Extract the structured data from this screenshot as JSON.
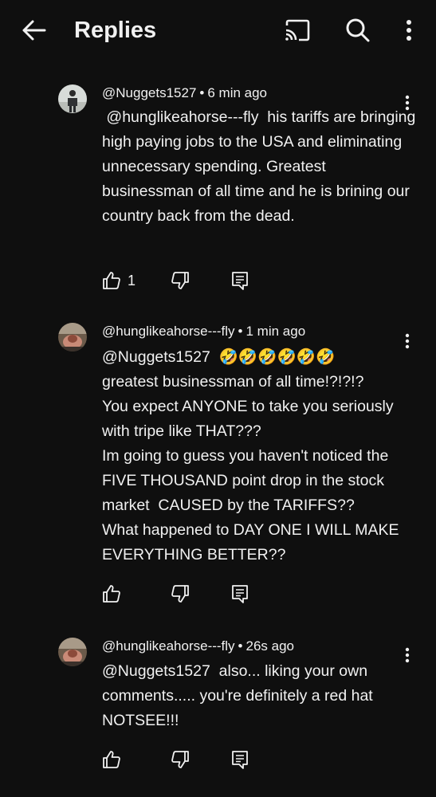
{
  "header": {
    "title": "Replies",
    "back_icon": "arrow-left-icon",
    "cast_icon": "cast-icon",
    "search_icon": "search-icon",
    "more_icon": "more-vertical-icon"
  },
  "replies": [
    {
      "author": "@Nuggets1527",
      "time": "6 min ago",
      "text": " @hunglikeahorse---fly  his tariffs are bringing high paying jobs to the USA and eliminating unnecessary spending. Greatest businessman of all time and he is brining our country back from the dead.",
      "like_count": "1"
    },
    {
      "author": "@hunglikeahorse---fly",
      "time": "1 min ago",
      "text": "@Nuggets1527  🤣🤣🤣🤣🤣🤣\ngreatest businessman of all time!?!?!?\nYou expect ANYONE to take you seriously with tripe like THAT???\nIm going to guess you haven't noticed the FIVE THOUSAND point drop in the stock market  CAUSED by the TARIFFS??\nWhat happened to DAY ONE I WILL MAKE EVERYTHING BETTER??",
      "like_count": ""
    },
    {
      "author": "@hunglikeahorse---fly",
      "time": "26s ago",
      "text": "@Nuggets1527  also... liking your own comments..... you're definitely a red hat NOTSEE!!!",
      "like_count": ""
    }
  ],
  "separator": "•",
  "colors": {
    "background": "#0f0f0f",
    "text": "#f1f1f1"
  }
}
